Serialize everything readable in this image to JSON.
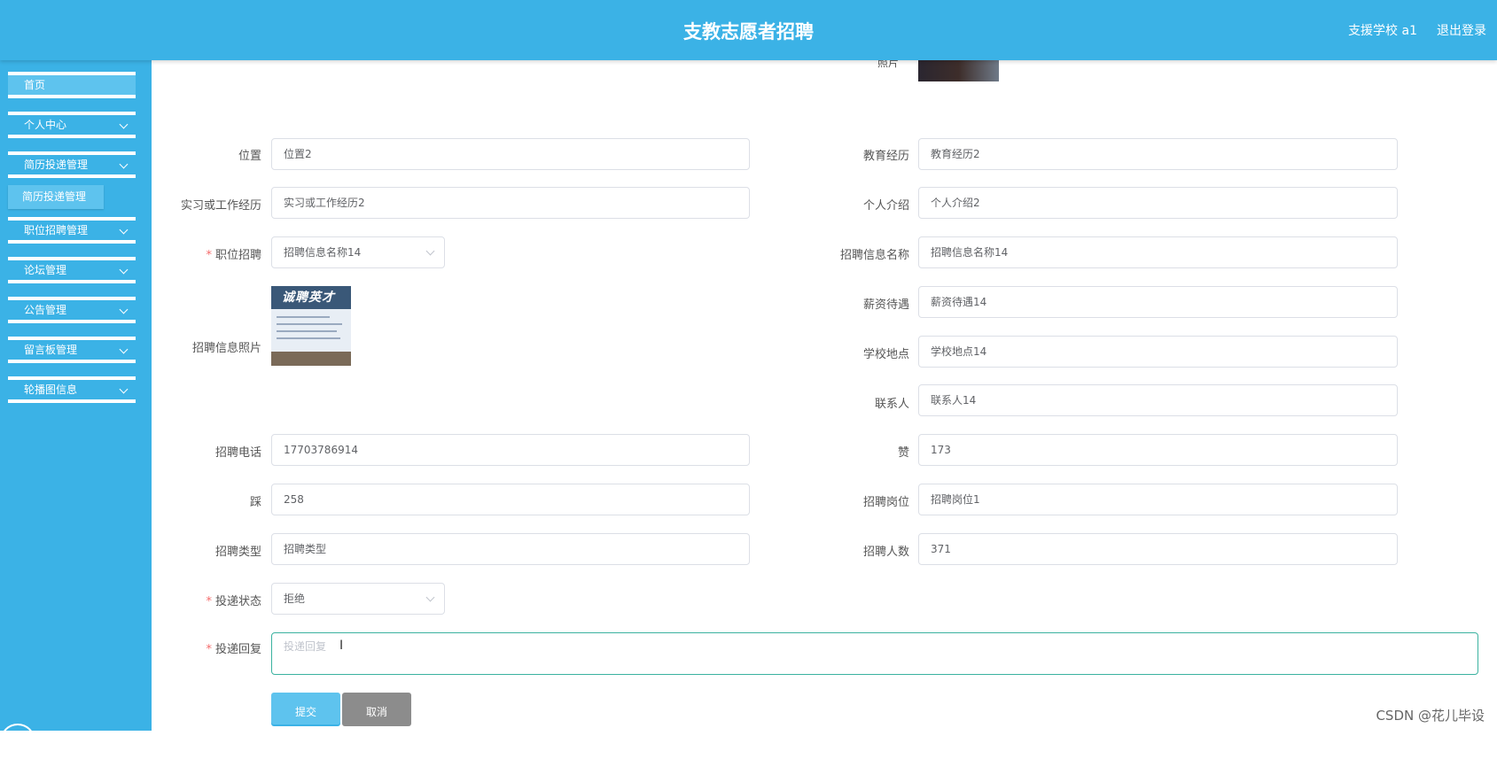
{
  "header": {
    "title": "支教志愿者招聘",
    "user": "支援学校 a1",
    "logout": "退出登录"
  },
  "sidebar": {
    "items": [
      {
        "label": "首页"
      },
      {
        "label": "个人中心"
      },
      {
        "label": "简历投递管理"
      },
      {
        "label": "职位招聘管理"
      },
      {
        "label": "论坛管理"
      },
      {
        "label": "公告管理"
      },
      {
        "label": "留言板管理"
      },
      {
        "label": "轮播图信息"
      }
    ],
    "submenu": "简历投递管理"
  },
  "form": {
    "photo_label": "照片",
    "position": {
      "label": "位置",
      "value": "位置2"
    },
    "education": {
      "label": "教育经历",
      "value": "教育经历2"
    },
    "experience": {
      "label": "实习或工作经历",
      "value": "实习或工作经历2"
    },
    "intro": {
      "label": "个人介绍",
      "value": "个人介绍2"
    },
    "job": {
      "label": "职位招聘",
      "value": "招聘信息名称14"
    },
    "job_name": {
      "label": "招聘信息名称",
      "value": "招聘信息名称14"
    },
    "job_photo": {
      "label": "招聘信息照片",
      "image_text": "诚聘英才"
    },
    "salary": {
      "label": "薪资待遇",
      "value": "薪资待遇14"
    },
    "school_location": {
      "label": "学校地点",
      "value": "学校地点14"
    },
    "contact": {
      "label": "联系人",
      "value": "联系人14"
    },
    "phone": {
      "label": "招聘电话",
      "value": "17703786914"
    },
    "likes": {
      "label": "赞",
      "value": "173"
    },
    "dislikes": {
      "label": "踩",
      "value": "258"
    },
    "post": {
      "label": "招聘岗位",
      "value": "招聘岗位1"
    },
    "type": {
      "label": "招聘类型",
      "value": "招聘类型"
    },
    "count": {
      "label": "招聘人数",
      "value": "371"
    },
    "status": {
      "label": "投递状态",
      "value": "拒绝"
    },
    "reply": {
      "label": "投递回复",
      "placeholder": "投递回复"
    }
  },
  "buttons": {
    "submit": "提交",
    "cancel": "取消"
  },
  "watermark": "CSDN @花儿毕设"
}
